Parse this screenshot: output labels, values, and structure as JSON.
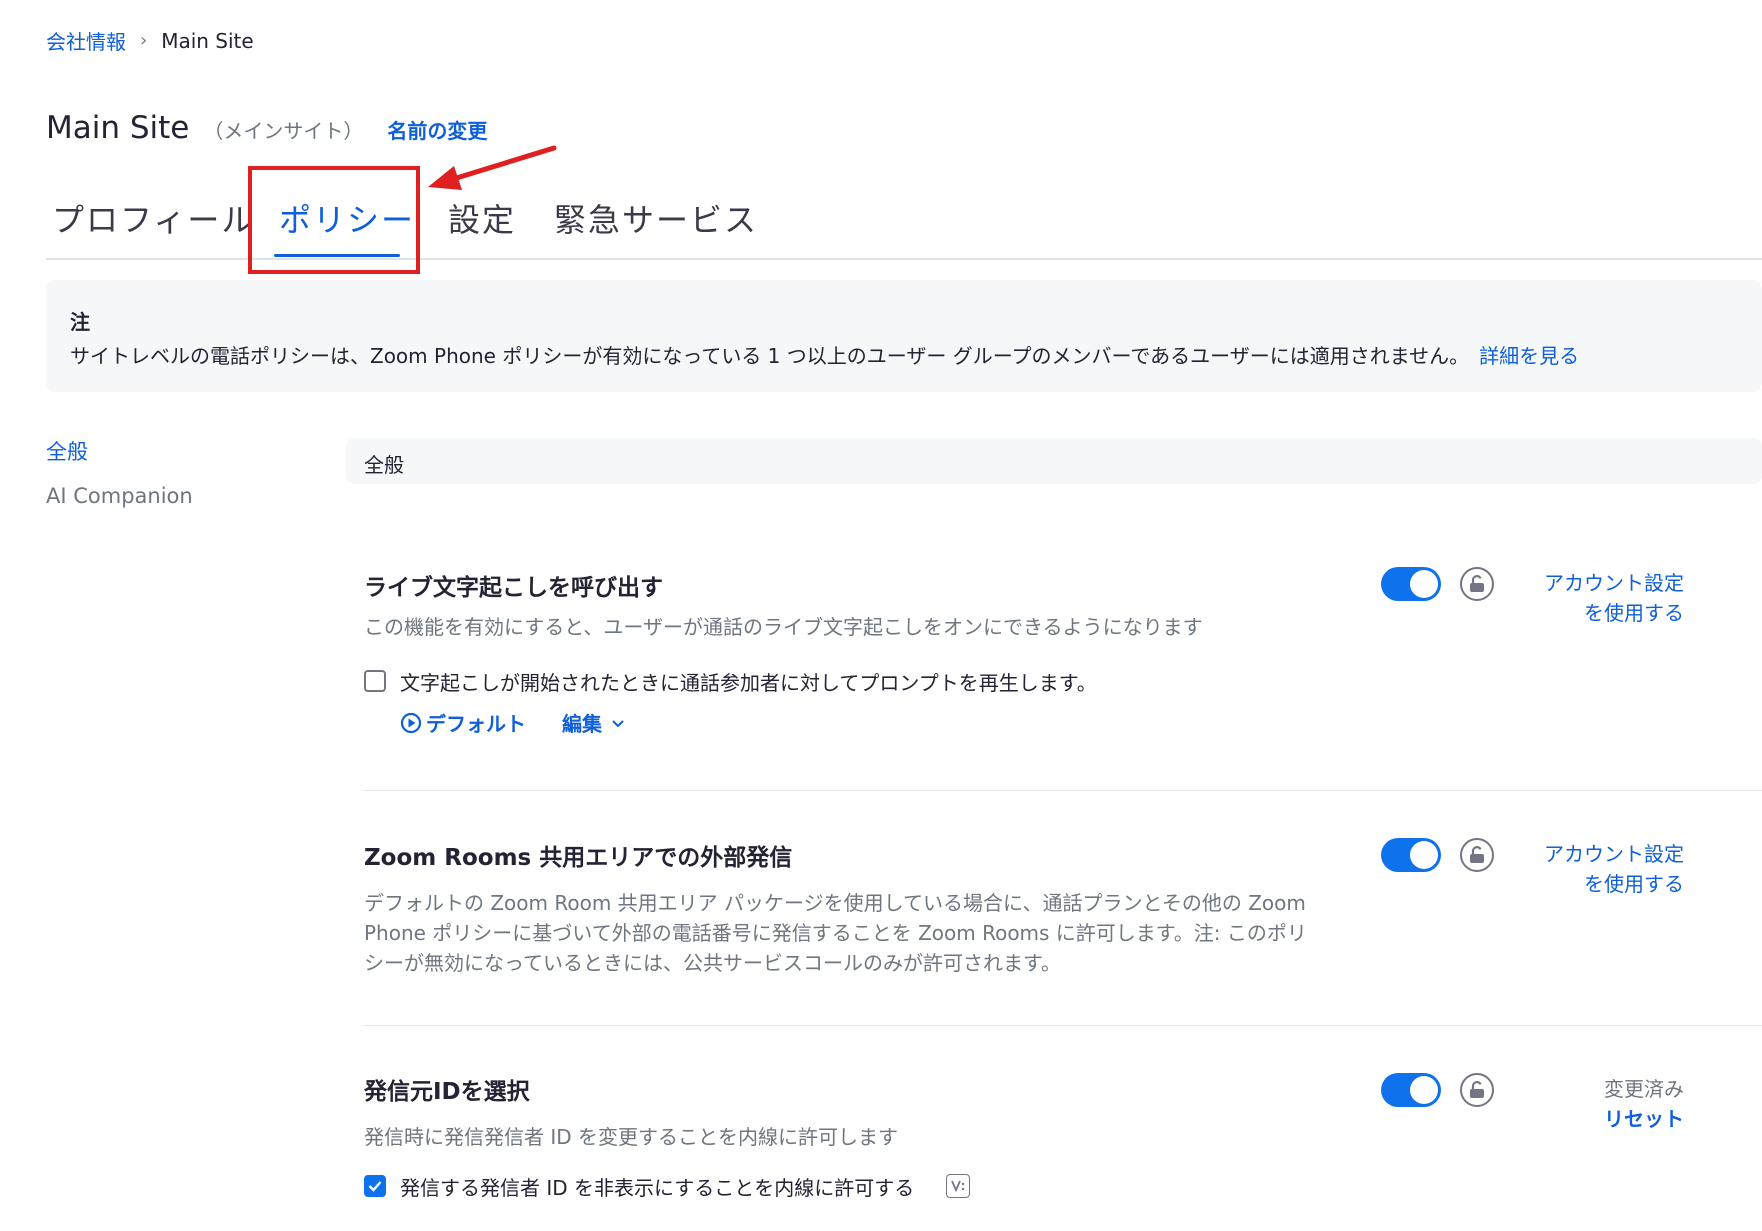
{
  "breadcrumb": {
    "parent": "会社情報",
    "separator": "›",
    "current": "Main Site"
  },
  "header": {
    "title": "Main Site",
    "subtitle": "（メインサイト）",
    "rename_label": "名前の変更"
  },
  "tabs": [
    {
      "label": "プロフィール"
    },
    {
      "label": "ポリシー"
    },
    {
      "label": "設定"
    },
    {
      "label": "緊急サービス"
    }
  ],
  "notice": {
    "heading": "注",
    "body": "サイトレベルの電話ポリシーは、Zoom Phone ポリシーが有効になっている 1 つ以上のユーザー グループのメンバーであるユーザーには適用されません。",
    "link": "詳細を見る"
  },
  "sidenav": {
    "items": [
      {
        "label": "全般"
      },
      {
        "label": "AI Companion"
      }
    ]
  },
  "section": {
    "title": "全般"
  },
  "settings": [
    {
      "title": "ライブ文字起こしを呼び出す",
      "description": "この機能を有効にすると、ユーザーが通話のライブ文字起こしをオンにできるようになります",
      "checkbox_label": "文字起こしが開始されたときに通話参加者に対してプロンプトを再生します。",
      "default_label": "デフォルト",
      "edit_label": "編集",
      "link_line1": "アカウント設定",
      "link_line2": "を使用する"
    },
    {
      "title": "Zoom Rooms 共用エリアでの外部発信",
      "description_lines": [
        "デフォルトの Zoom Room 共用エリア パッケージを使用している場合に、通話プランとその他の Zoom",
        "Phone ポリシーに基づいて外部の電話番号に発信することを Zoom Rooms に許可します。注: このポリ",
        "シーが無効になっているときには、公共サービスコールのみが許可されます。"
      ],
      "link_line1": "アカウント設定",
      "link_line2": "を使用する"
    },
    {
      "title": "発信元IDを選択",
      "description": "発信時に発信発信者 ID を変更することを内線に許可します",
      "checkbox_label": "発信する発信者 ID を非表示にすることを内線に許可する",
      "status_label": "変更済み",
      "reset_label": "リセット"
    }
  ],
  "colors": {
    "accent": "#0e72ed",
    "link": "#0e5fd9",
    "annotation": "#e02020"
  }
}
